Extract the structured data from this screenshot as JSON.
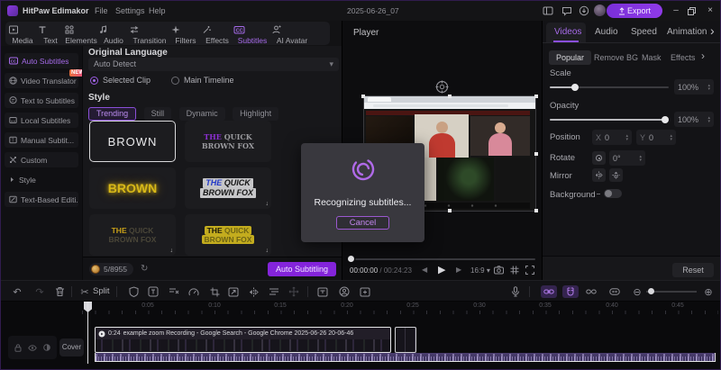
{
  "colors": {
    "accent_purple": "#a56ae8",
    "export_button": "#7a2fd8",
    "auto_subtitling_button": "#8424da",
    "new_badge": "#e8703a",
    "credits_coin": "#c8923a",
    "waveform_purple": "#4a3d6e",
    "style_yellow": "#d8b818",
    "selection_border": "#e4e4e6"
  },
  "titlebar": {
    "app_name": "HitPaw Edimakor",
    "menu": [
      {
        "label": "File"
      },
      {
        "label": "Settings"
      },
      {
        "label": "Help"
      }
    ],
    "project_title": "2025-06-26_07",
    "export_label": "Export",
    "window": {
      "minimize": "–",
      "close": "×"
    }
  },
  "ribbon": {
    "tabs": [
      {
        "label": "Media"
      },
      {
        "label": "Text"
      },
      {
        "label": "Elements"
      },
      {
        "label": "Audio"
      },
      {
        "label": "Transition"
      },
      {
        "label": "Filters"
      },
      {
        "label": "Effects"
      },
      {
        "label": "Subtitles",
        "active": true
      },
      {
        "label": "AI Avatar"
      }
    ]
  },
  "sidebar": {
    "items": [
      {
        "label": "Auto Subtitles",
        "active": true
      },
      {
        "label": "Video Translator",
        "badge": "NEW"
      },
      {
        "label": "Text to Subtitles"
      },
      {
        "label": "Local Subtitles"
      },
      {
        "label": "Manual Subtit..."
      },
      {
        "label": "Custom"
      },
      {
        "label": "Style"
      },
      {
        "label": "Text-Based Editi..."
      }
    ]
  },
  "subtitles_panel": {
    "original_language_label": "Original Language",
    "language_value": "Auto Detect",
    "source_options": [
      {
        "label": "Selected Clip",
        "selected": true
      },
      {
        "label": "Main Timeline",
        "selected": false
      }
    ],
    "style_label": "Style",
    "style_tabs": [
      {
        "label": "Trending",
        "active": true
      },
      {
        "label": "Still"
      },
      {
        "label": "Dynamic"
      },
      {
        "label": "Highlight"
      }
    ],
    "style_cards": [
      {
        "text": "BROWN",
        "variant": "outline-white",
        "selected": true
      },
      {
        "the": "THE",
        "rest": " QUICK",
        "line2": "BROWN FOX",
        "variant": "serif-purple"
      },
      {
        "text": "BROWN",
        "variant": "yellow-glow"
      },
      {
        "the": "THE",
        "rest": " QUICK",
        "line2": "BROWN FOX",
        "variant": "italic-chip",
        "downloadable": true
      },
      {
        "the": "THE",
        "rest": " QUICK",
        "line2": "BROWN FOX",
        "variant": "yellow-word",
        "downloadable": true
      },
      {
        "the": "THE",
        "rest": " QUICK",
        "line2": "BROWN FOX",
        "variant": "yellow-highlight",
        "downloadable": true
      }
    ],
    "credits": "5/8955",
    "auto_subtitling_label": "Auto Subtitling"
  },
  "player": {
    "title": "Player",
    "time_current": "00:00:00",
    "time_separator": " / ",
    "time_total": "00:24:23",
    "aspect_ratio": "16:9"
  },
  "properties_panel": {
    "tabs": [
      {
        "label": "Videos",
        "active": true
      },
      {
        "label": "Audio"
      },
      {
        "label": "Speed"
      },
      {
        "label": "Animation"
      }
    ],
    "subtabs": [
      {
        "label": "Popular",
        "active": true
      },
      {
        "label": "Remove BG"
      },
      {
        "label": "Mask"
      },
      {
        "label": "Effects"
      }
    ],
    "scale": {
      "label": "Scale",
      "value": "100%"
    },
    "opacity": {
      "label": "Opacity",
      "value": "100%"
    },
    "position": {
      "label": "Position",
      "x_prefix": "X",
      "x": "0",
      "y_prefix": "Y",
      "y": "0"
    },
    "rotate": {
      "label": "Rotate",
      "value": "0°"
    },
    "mirror": {
      "label": "Mirror"
    },
    "background": {
      "label": "Background",
      "enabled": false
    },
    "reset_label": "Reset"
  },
  "modal": {
    "message": "Recognizing subtitles...",
    "cancel_label": "Cancel"
  },
  "toolbar": {
    "split_label": "Split"
  },
  "timeline": {
    "ruler_labels": [
      "0:05",
      "0:10",
      "0:15",
      "0:20",
      "0:25",
      "0:30",
      "0:35",
      "0:40",
      "0:45"
    ],
    "cover_label": "Cover",
    "clip": {
      "duration": "0:24",
      "title": "example zoom Recording - Google Search - Google Chrome 2025-06-26 20-06-46"
    }
  },
  "icons": {
    "undo": "↶",
    "redo": "↷",
    "scissors": "✂",
    "caret_down": "▾",
    "zoom_out": "⊖",
    "zoom_in": "⊕",
    "chevron_right": "›",
    "download_arrow": "↓",
    "refresh": "↻",
    "prev": "◀",
    "play": "▶",
    "next": "▶"
  }
}
